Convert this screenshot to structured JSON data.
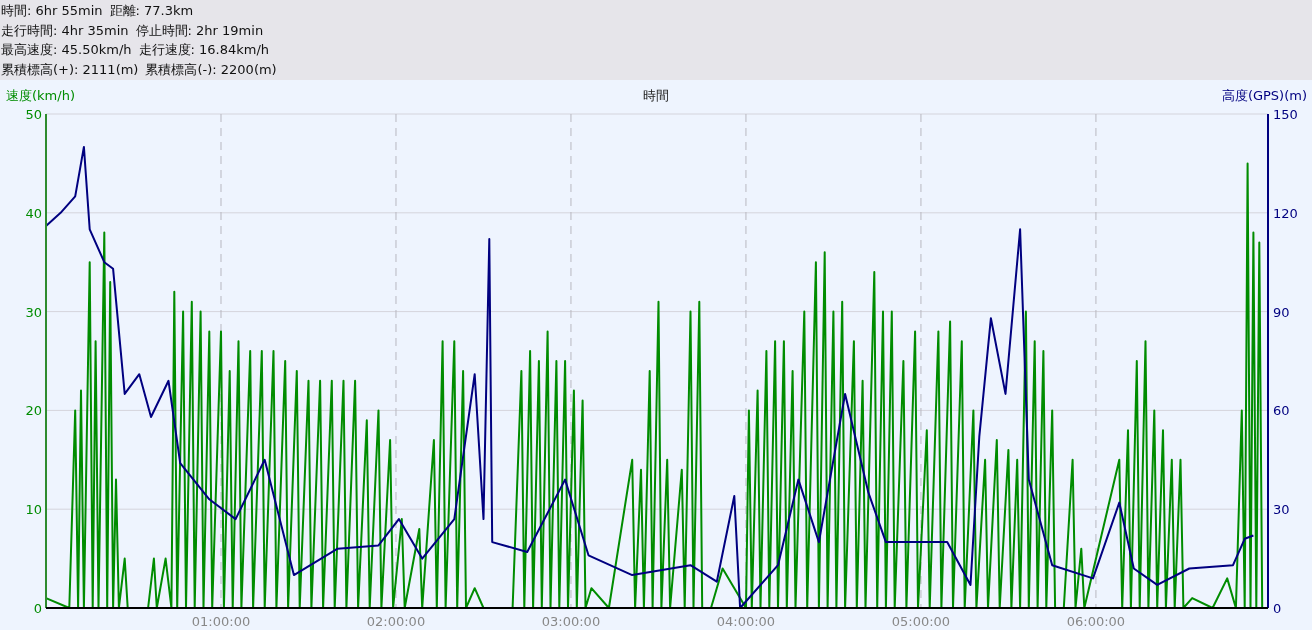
{
  "summary": {
    "lines": [
      [
        "時間: 6hr 55min",
        "距離: 77.3km"
      ],
      [
        "走行時間: 4hr 35min",
        "停止時間: 2hr 19min"
      ],
      [
        "最高速度: 45.50km/h",
        "走行速度: 16.84km/h"
      ],
      [
        "累積標高(+): 2111(m)",
        "累積標高(-): 2200(m)"
      ]
    ]
  },
  "chart": {
    "chart_data": {
      "type": "line",
      "grid": true,
      "xlabel": "時間",
      "ylabel": "速度(km/h)",
      "y2label": "高度(GPS)(m)",
      "xlim": [
        0,
        419
      ],
      "ylim": [
        0,
        50
      ],
      "y2lim": [
        0,
        150
      ],
      "xticks": [
        {
          "value": 60,
          "label": "01:00:00"
        },
        {
          "value": 120,
          "label": "02:00:00"
        },
        {
          "value": 180,
          "label": "03:00:00"
        },
        {
          "value": 240,
          "label": "04:00:00"
        },
        {
          "value": 300,
          "label": "05:00:00"
        },
        {
          "value": 360,
          "label": "06:00:00"
        }
      ],
      "yticks": [
        0,
        10,
        20,
        30,
        40,
        50
      ],
      "y2ticks": [
        0,
        30,
        60,
        90,
        120,
        150
      ],
      "series": [
        {
          "color": "#008c00",
          "x": [
            0,
            8,
            10,
            11,
            12,
            13,
            15,
            16,
            17,
            18,
            20,
            21,
            22,
            23,
            24,
            25,
            27,
            28,
            35,
            37,
            38,
            41,
            43,
            44,
            45,
            47,
            48,
            50,
            51,
            53,
            54,
            56,
            57,
            60,
            61,
            63,
            64,
            66,
            67,
            70,
            71,
            74,
            75,
            78,
            79,
            82,
            83,
            86,
            87,
            90,
            91,
            94,
            95,
            98,
            99,
            102,
            103,
            106,
            107,
            110,
            111,
            114,
            115,
            118,
            119,
            122,
            123,
            128,
            129,
            133,
            134,
            136,
            137,
            140,
            141,
            143,
            144,
            147,
            150,
            160,
            163,
            164,
            166,
            167,
            169,
            170,
            172,
            173,
            175,
            176,
            178,
            179,
            181,
            182,
            184,
            185,
            187,
            193,
            201,
            202,
            204,
            205,
            207,
            208,
            210,
            211,
            213,
            214,
            218,
            219,
            221,
            222,
            224,
            225,
            228,
            232,
            240,
            241,
            242,
            244,
            245,
            247,
            248,
            250,
            251,
            253,
            254,
            256,
            257,
            260,
            261,
            264,
            265,
            267,
            268,
            270,
            271,
            273,
            274,
            277,
            278,
            280,
            281,
            284,
            285,
            287,
            288,
            290,
            291,
            294,
            295,
            298,
            299,
            302,
            303,
            306,
            307,
            310,
            311,
            314,
            315,
            318,
            319,
            322,
            323,
            326,
            327,
            330,
            331,
            333,
            334,
            336,
            337,
            339,
            340,
            342,
            343,
            345,
            346,
            349,
            352,
            353,
            355,
            356,
            368,
            369,
            371,
            372,
            374,
            375,
            377,
            378,
            380,
            381,
            383,
            384,
            386,
            387,
            389,
            390,
            393,
            400,
            405,
            408,
            410,
            411,
            412,
            413,
            414,
            415,
            416,
            417
          ],
          "values": [
            1,
            0,
            20,
            0,
            22,
            0,
            35,
            0,
            27,
            0,
            38,
            0,
            33,
            0,
            13,
            0,
            5,
            0,
            0,
            5,
            0,
            5,
            0,
            32,
            0,
            30,
            0,
            31,
            0,
            30,
            0,
            28,
            0,
            28,
            0,
            24,
            0,
            27,
            0,
            26,
            0,
            26,
            0,
            26,
            0,
            25,
            0,
            24,
            0,
            23,
            0,
            23,
            0,
            23,
            0,
            23,
            0,
            23,
            0,
            19,
            0,
            20,
            0,
            17,
            0,
            9,
            0,
            8,
            0,
            17,
            0,
            27,
            0,
            27,
            0,
            24,
            0,
            2,
            0,
            0,
            24,
            0,
            26,
            0,
            25,
            0,
            28,
            0,
            25,
            0,
            25,
            0,
            22,
            0,
            21,
            0,
            2,
            0,
            15,
            0,
            14,
            0,
            24,
            0,
            31,
            0,
            15,
            0,
            14,
            0,
            30,
            0,
            31,
            0,
            0,
            4,
            0,
            20,
            0,
            22,
            0,
            26,
            0,
            27,
            0,
            27,
            0,
            24,
            0,
            30,
            0,
            35,
            0,
            36,
            0,
            30,
            0,
            31,
            0,
            27,
            0,
            23,
            0,
            34,
            0,
            30,
            0,
            30,
            0,
            25,
            0,
            28,
            0,
            18,
            0,
            28,
            0,
            29,
            0,
            27,
            0,
            20,
            0,
            15,
            0,
            17,
            0,
            16,
            0,
            15,
            0,
            30,
            0,
            27,
            0,
            26,
            0,
            20,
            0,
            0,
            15,
            0,
            6,
            0,
            15,
            0,
            18,
            0,
            25,
            0,
            27,
            0,
            20,
            0,
            18,
            0,
            15,
            0,
            15,
            0,
            1,
            0,
            3,
            0,
            20,
            0,
            45,
            0,
            38,
            0,
            37,
            0
          ]
        },
        {
          "color": "#000080",
          "axis": "y2",
          "x": [
            0,
            5,
            10,
            13,
            15,
            20,
            23,
            27,
            32,
            36,
            42,
            46,
            56,
            65,
            75,
            85,
            100,
            114,
            121,
            129,
            140,
            147,
            150,
            152,
            153,
            165,
            178,
            186,
            201,
            221,
            230,
            236,
            238,
            251,
            258,
            265,
            274,
            282,
            288,
            297,
            309,
            317,
            320,
            324,
            329,
            334,
            337,
            345,
            359,
            368,
            373,
            381,
            392,
            407,
            411,
            414
          ],
          "values": [
            116,
            120,
            125,
            140,
            115,
            105,
            103,
            65,
            71,
            58,
            69,
            44,
            33,
            27,
            45,
            10,
            18,
            19,
            27,
            15,
            27,
            71,
            27,
            112,
            20,
            17,
            39,
            16,
            10,
            13,
            8,
            34,
            0,
            13,
            39,
            20,
            65,
            35,
            20,
            20,
            20,
            7,
            52,
            88,
            65,
            115,
            39,
            13,
            9,
            32,
            12,
            7,
            12,
            13,
            21,
            22
          ]
        }
      ]
    }
  }
}
